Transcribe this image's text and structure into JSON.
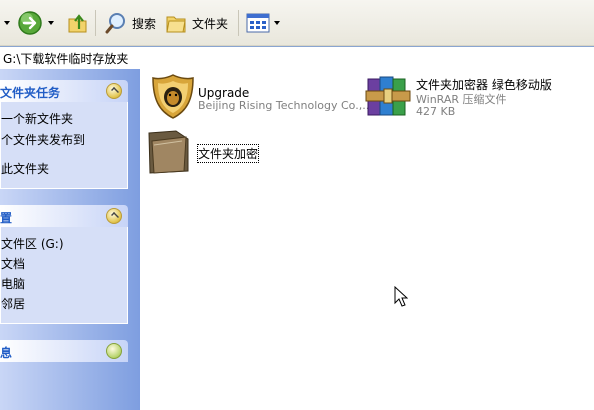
{
  "toolbar": {
    "search_label": "搜索",
    "folders_label": "文件夹"
  },
  "address": {
    "path": "G:\\下载软件临时存放夹"
  },
  "left": {
    "tasks": {
      "title": "文件夹任务",
      "items": [
        "一个新文件夹",
        "个文件夹发布到",
        "此文件夹"
      ]
    },
    "places": {
      "title": "置",
      "items": [
        "文件区 (G:)",
        "文档",
        "电脑",
        "邻居"
      ]
    },
    "details": {
      "title": "息"
    }
  },
  "files": [
    {
      "name": "Upgrade",
      "sub1": "Beijing Rising Technology Co.,...",
      "icon": "shield-lion-icon"
    },
    {
      "name": "文件夹加密器 绿色移动版",
      "sub1": "WinRAR 压缩文件",
      "sub2": "427 KB",
      "icon": "winrar-archive-icon"
    },
    {
      "name": "文件夹加密",
      "icon": "folder-icon"
    }
  ]
}
